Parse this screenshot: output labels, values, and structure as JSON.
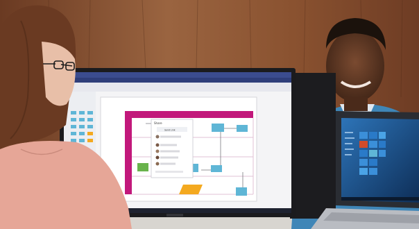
{
  "scene": {
    "description_label": "",
    "colors": {
      "wall_wood": "#8a5230",
      "wall_wood_dark": "#5e3420",
      "monitor_bezel": "#1b1b1e",
      "visio_header": "#3b4c8f",
      "swimlane_accent": "#c2187b",
      "flow_shape_blue": "#5fb6d6",
      "flow_shape_green": "#69b34c",
      "flow_shape_orange": "#f4a91f",
      "laptop_screen": "#1a4f86",
      "sweater": "#e6a697",
      "shirt": "#3f86b7",
      "hair": "#6a3a22"
    },
    "share_dialog": {
      "title": "Share",
      "send_link": "Send Link"
    },
    "taskbar_icons": [
      "windows-icon",
      "search-icon",
      "file-explorer-icon",
      "edge-icon",
      "visio-icon"
    ]
  }
}
